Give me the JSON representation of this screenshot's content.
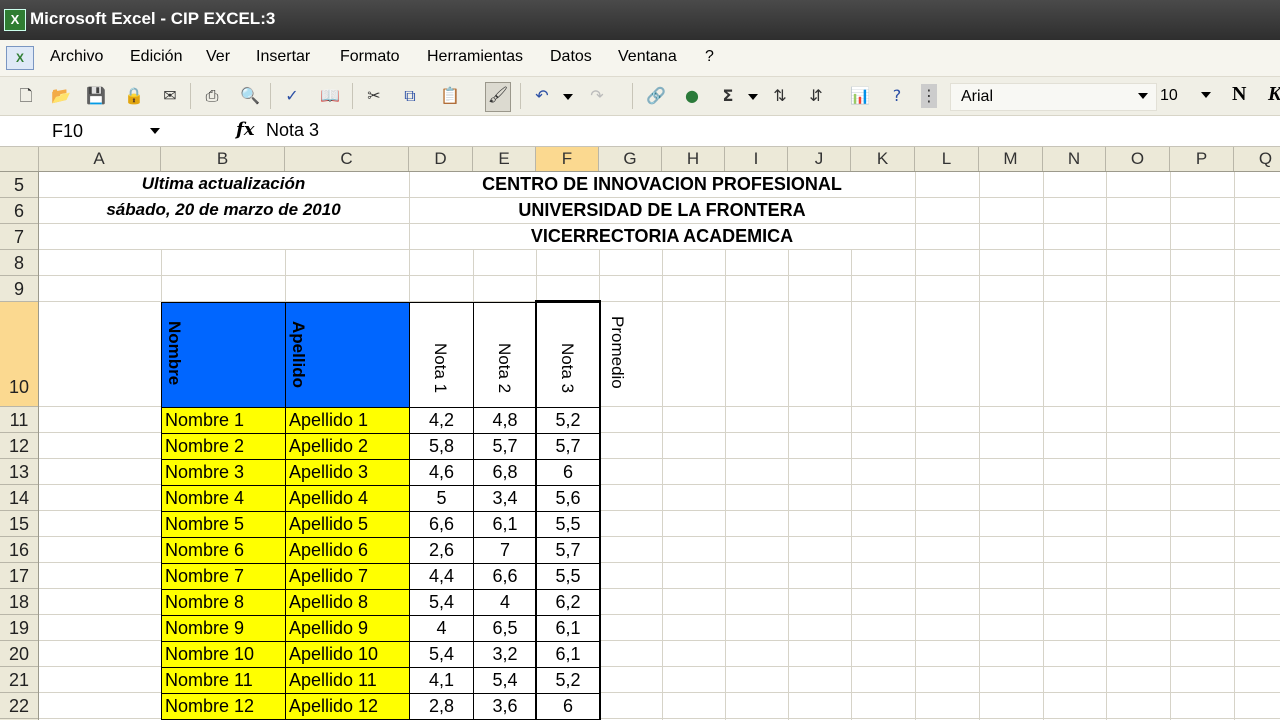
{
  "window": {
    "title": "Microsoft Excel - CIP EXCEL:3",
    "app_icon": "excel-icon"
  },
  "menu": [
    "Archivo",
    "Edición",
    "Ver",
    "Insertar",
    "Formato",
    "Herramientas",
    "Datos",
    "Ventana",
    "?"
  ],
  "toolbar": {
    "icons": [
      "new-icon",
      "open-icon",
      "save-icon",
      "permission-icon",
      "email-icon",
      "print-icon",
      "print-preview-icon",
      "spelling-icon",
      "research-icon",
      "cut-icon",
      "copy-icon",
      "paste-icon",
      "format-painter-icon",
      "undo-icon",
      "redo-icon",
      "hyperlink-icon",
      "drawing-icon",
      "autosum-icon",
      "sort-asc-icon",
      "sort-desc-icon",
      "chart-wizard-icon",
      "help-icon"
    ],
    "font": "Arial",
    "size": "10",
    "bold": "N",
    "italic": "K"
  },
  "formula_bar": {
    "name_box": "F10",
    "fx": "fx",
    "formula": "Nota 3"
  },
  "columns": [
    "A",
    "B",
    "C",
    "D",
    "E",
    "F",
    "G",
    "H",
    "I",
    "J",
    "K",
    "L",
    "M",
    "N",
    "O",
    "P",
    "Q"
  ],
  "selected_column": "F",
  "rows": [
    "5",
    "6",
    "7",
    "8",
    "9",
    "10",
    "11",
    "12",
    "13",
    "14",
    "15",
    "16",
    "17",
    "18",
    "19",
    "20",
    "21",
    "22"
  ],
  "selected_row": "10",
  "sheet": {
    "update_line1": "Ultima actualización",
    "update_line2": "sábado, 20 de marzo de 2010",
    "header1": "CENTRO DE INNOVACION PROFESIONAL",
    "header2": "UNIVERSIDAD DE LA FRONTERA",
    "header3": "VICERRECTORIA ACADEMICA",
    "col_headers": [
      "Nombre",
      "Apellido",
      "Nota 1",
      "Nota 2",
      "Nota 3",
      "Promedio"
    ],
    "students": [
      {
        "nombre": "Nombre 1",
        "apellido": "Apellido 1",
        "n1": "4,2",
        "n2": "4,8",
        "n3": "5,2"
      },
      {
        "nombre": "Nombre 2",
        "apellido": "Apellido 2",
        "n1": "5,8",
        "n2": "5,7",
        "n3": "5,7"
      },
      {
        "nombre": "Nombre 3",
        "apellido": "Apellido 3",
        "n1": "4,6",
        "n2": "6,8",
        "n3": "6"
      },
      {
        "nombre": "Nombre 4",
        "apellido": "Apellido 4",
        "n1": "5",
        "n2": "3,4",
        "n3": "5,6"
      },
      {
        "nombre": "Nombre 5",
        "apellido": "Apellido 5",
        "n1": "6,6",
        "n2": "6,1",
        "n3": "5,5"
      },
      {
        "nombre": "Nombre 6",
        "apellido": "Apellido 6",
        "n1": "2,6",
        "n2": "7",
        "n3": "5,7"
      },
      {
        "nombre": "Nombre 7",
        "apellido": "Apellido 7",
        "n1": "4,4",
        "n2": "6,6",
        "n3": "5,5"
      },
      {
        "nombre": "Nombre 8",
        "apellido": "Apellido 8",
        "n1": "5,4",
        "n2": "4",
        "n3": "6,2"
      },
      {
        "nombre": "Nombre 9",
        "apellido": "Apellido 9",
        "n1": "4",
        "n2": "6,5",
        "n3": "6,1"
      },
      {
        "nombre": "Nombre 10",
        "apellido": "Apellido 10",
        "n1": "5,4",
        "n2": "3,2",
        "n3": "6,1"
      },
      {
        "nombre": "Nombre 11",
        "apellido": "Apellido 11",
        "n1": "4,1",
        "n2": "5,4",
        "n3": "5,2"
      },
      {
        "nombre": "Nombre 12",
        "apellido": "Apellido 12",
        "n1": "2,8",
        "n2": "3,6",
        "n3": "6"
      }
    ]
  },
  "colors": {
    "name_fill": "#ffff00",
    "header_fill": "#0066ff",
    "selection_highlight": "#fbd990"
  }
}
